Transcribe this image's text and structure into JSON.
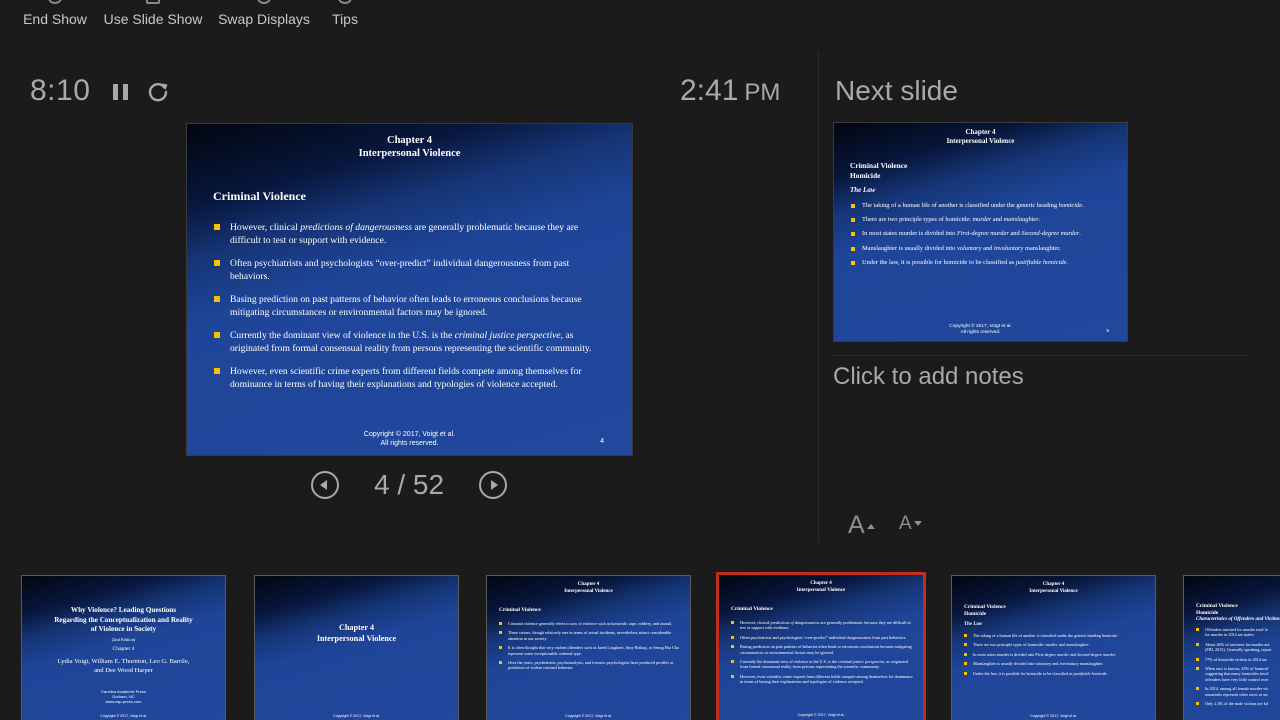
{
  "toolbar": {
    "end_show": "End Show",
    "use_slide_show": "Use Slide Show",
    "swap_displays": "Swap Displays",
    "tips": "Tips"
  },
  "timer": {
    "elapsed": "8:10"
  },
  "clock": {
    "time": "2:41",
    "ampm": "PM"
  },
  "current_slide": {
    "heading_1": "Chapter 4",
    "heading_2": "Interpersonal Violence",
    "title": "Criminal Violence",
    "copyright_1": "Copyright © 2017, Voigt et al.",
    "copyright_2": "All rights reserved.",
    "number": "4"
  },
  "navigation": {
    "current": "4",
    "total": "52",
    "separator": "/"
  },
  "next_slide": {
    "label": "Next slide",
    "heading_1": "Chapter 4",
    "heading_2": "Interpersonal Violence",
    "title_1": "Criminal Violence",
    "title_2": "Homicide",
    "subtitle": "The Law",
    "copyright_1": "Copyright © 2017, Voigt et al.",
    "copyright_2": "All rights reserved.",
    "number": "5"
  },
  "notes": {
    "placeholder": "Click to add notes"
  },
  "font_controls": {
    "increase": "A",
    "decrease": "A"
  },
  "filmstrip": {
    "thumb1": {
      "title_1": "Why Violence? Leading Questions",
      "title_2": "Regarding the Conceptualization and Reality",
      "title_3": "of Violence in Society",
      "edition": "(2nd Edition)",
      "chapter": "Chapter 4",
      "authors_1": "Lydia Voigt, William E. Thornton, Leo G. Barrile,",
      "authors_2": "and Dee Wood Harper",
      "publisher_1": "Carolina Academic Press",
      "publisher_2": "Durham, NC",
      "publisher_3": "www.cap-press.com",
      "copyright": "Copyright © 2017, Voigt et al."
    },
    "thumb2": {
      "heading_1": "Chapter 4",
      "heading_2": "Interpersonal Violence",
      "copyright": "Copyright © 2017, Voigt et al."
    },
    "thumb3": {
      "heading_1": "Chapter 4",
      "heading_2": "Interpersonal Violence",
      "title": "Criminal Violence",
      "b1": "Criminal violence generally refers to acts of violence such as homicide, rape, robbery, and assault.",
      "b2": "These crimes, though relatively rare in terms of actual incidents, nevertheless attract considerable attention in our society.",
      "b3": "It is often thought that very violent offenders such as Jared Loughner, Amy Bishop, or Seung Hui Cho represent some exceptionable criminal type.",
      "b4": "Over the years, psychiatrists, psychoanalysts, and forensic psychologists have produced profiles or predictors of violent criminal behavior.",
      "copyright": "Copyright © 2017, Voigt et al."
    },
    "thumb4": {
      "heading_1": "Chapter 4",
      "heading_2": "Interpersonal Violence",
      "title": "Criminal Violence",
      "copyright": "Copyright © 2017, Voigt et al."
    },
    "thumb5": {
      "heading_1": "Chapter 4",
      "heading_2": "Interpersonal Violence",
      "title_1": "Criminal Violence",
      "title_2": "Homicide",
      "subtitle": "The Law",
      "copyright": "Copyright © 2017, Voigt et al."
    },
    "thumb6": {
      "title_1": "Criminal Violence",
      "title_2": "Homicide",
      "subtitle": "Characteristics of Offenders and Victims",
      "b1": "Offenders arrested for murder total fo",
      "b1b": "for murder in 2014 are males.",
      "b2": "About 46% of arrestees for murder are",
      "b2b": "(FBI, 2015). Generally speaking, report",
      "b3": "77% of homicide victims in 2014 are",
      "b4": "When race is known, 43% of homicid",
      "b4b": "suggesting that many homicides invol",
      "b4c": "offenders have very little control over",
      "b5": "In 2014, among all female murder vic",
      "b5b": "remainder represent other races or un",
      "b6": "Only 2.4% of the male victims are kil"
    }
  },
  "bullets_current": [
    {
      "pre": "However, clinical ",
      "em": "predictions of dangerousness",
      "post": "  are generally problematic because they are difficult to test or support with evidence."
    },
    {
      "pre": "Often psychiatrists and psychologists “over-predict” individual dangerousness from past behaviors.",
      "em": "",
      "post": ""
    },
    {
      "pre": "Basing prediction on past patterns of behavior often leads to erroneous conclusions because mitigating circumstances or environmental factors may be ignored.",
      "em": "",
      "post": ""
    },
    {
      "pre": "Currently the dominant view of violence in the U.S. is the ",
      "em": "criminal justice perspective",
      "post": ", as originated from formal consensual reality from persons representing the scientific community."
    },
    {
      "pre": "However, even scientific crime experts from different fields compete among themselves for dominance in terms of having their explanations and typologies of violence accepted.",
      "em": "",
      "post": ""
    }
  ],
  "bullets_next": [
    {
      "pre": "The taking of a human life of another is classified under the generic heading ",
      "em": "homicide",
      "post": "."
    },
    {
      "pre": "There are two principle types of homicide: ",
      "em": "murder",
      "post": " and ",
      "em2": "manslaughter",
      "post2": "."
    },
    {
      "pre": "In most states murder is divided into ",
      "em": "First-degree murder",
      "post": " and ",
      "em2": "Second-degree murder",
      "post2": "."
    },
    {
      "pre": "Manslaughter is usually divided into ",
      "em": "voluntary",
      "post": " and ",
      "em2": "involuntary",
      "post2": " manslaughter."
    },
    {
      "pre": "Under the law, it is possible for homicide to be classified as ",
      "em": "justifiable homicide",
      "post": "."
    }
  ],
  "colors": {
    "background": "#1b1b1b",
    "slide_blue": "#21489d",
    "bullet_yellow": "#f5c400",
    "selected_red": "#c62b1f",
    "text_gray": "#a9a9a9"
  }
}
